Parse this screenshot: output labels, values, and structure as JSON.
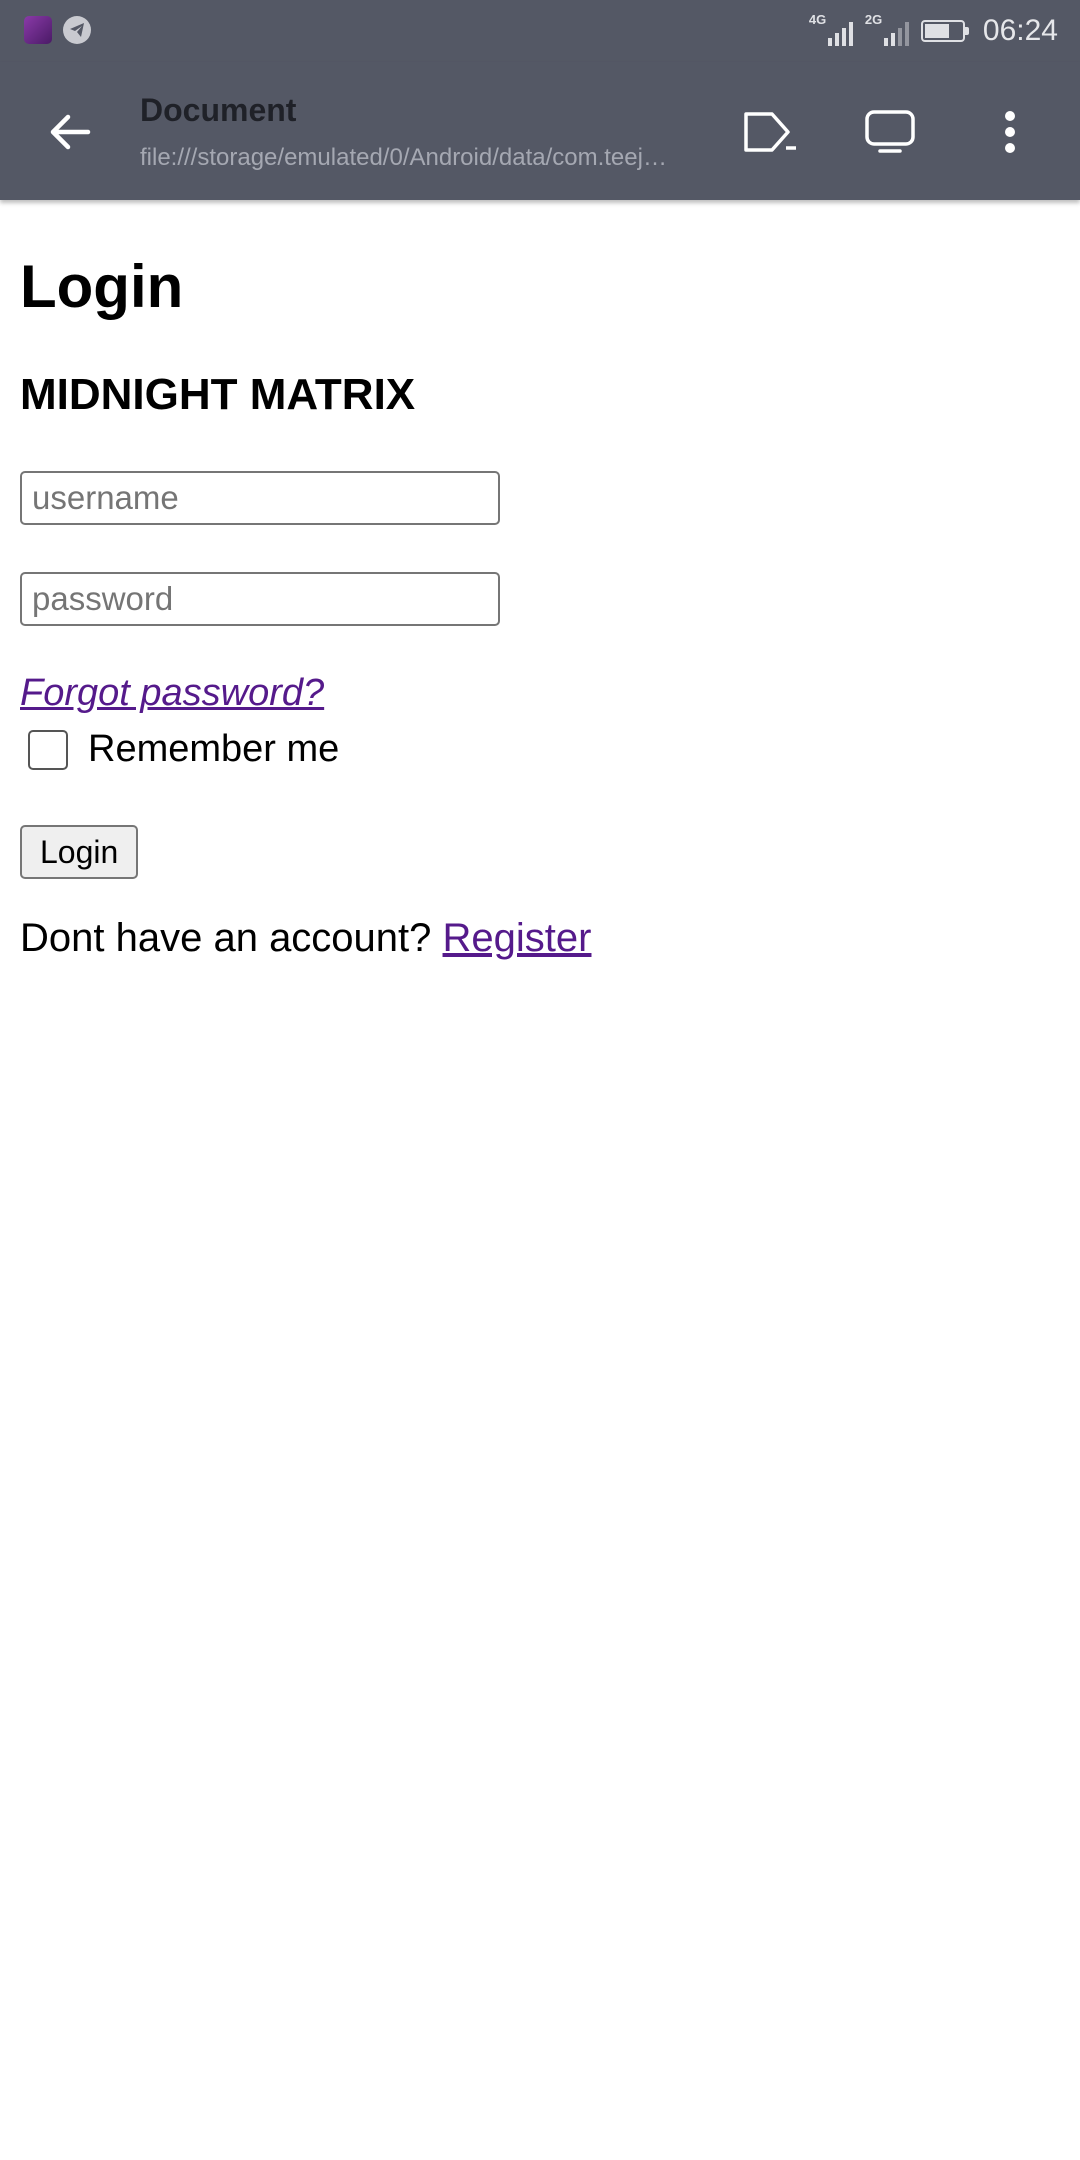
{
  "status_bar": {
    "time": "06:24",
    "network_1": "4G",
    "network_2": "2G",
    "battery_level": 0.7
  },
  "toolbar": {
    "title": "Document",
    "url": "file:///storage/emulated/0/Android/data/com.teej…",
    "icons": [
      "back-arrow-icon",
      "open-in-icon",
      "desktop-icon",
      "more-vert-icon"
    ]
  },
  "page": {
    "title": "Login",
    "site_name": "MIDNIGHT MATRIX",
    "username_placeholder": "username",
    "password_placeholder": "password",
    "forgot_link": "Forgot password?",
    "remember_label": "Remember me",
    "remember_checked": false,
    "login_button": "Login",
    "register_prompt": "Dont have an account?",
    "register_link": "Register"
  },
  "colors": {
    "bar_background": "#545865",
    "visited_link": "#551a8b"
  }
}
